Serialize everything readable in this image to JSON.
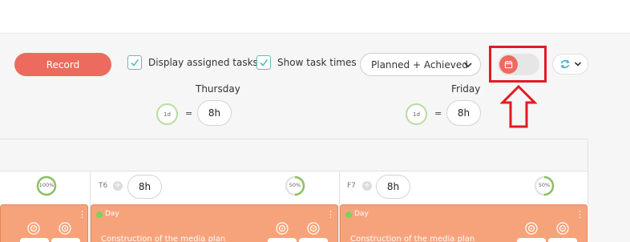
{
  "toolbar": {
    "record_label": "Record",
    "display_assigned_label": "Display assigned tasks",
    "show_times_label": "Show task times",
    "view_select_value": "Planned + Achieved"
  },
  "days": [
    {
      "label": "Thursday",
      "capacity": "1d",
      "equals": "=",
      "hours": "8h"
    },
    {
      "label": "Friday",
      "capacity": "1d",
      "equals": "=",
      "hours": "8h"
    }
  ],
  "columns": [
    {
      "code": "",
      "hours": "",
      "percent": "100%",
      "progress": 1.0
    },
    {
      "code": "T6",
      "hours": "8h",
      "percent": "50%",
      "progress": 0.5
    },
    {
      "code": "F7",
      "hours": "8h",
      "percent": "50%",
      "progress": 0.5
    }
  ],
  "tasks": [
    {
      "tag": "",
      "title": ""
    },
    {
      "tag": "Day",
      "title": "Construction of the media plan"
    },
    {
      "tag": "Day",
      "title": "Construction of the media plan"
    }
  ],
  "colors": {
    "accent": "#ec6b5e",
    "task_bg": "#f6a37c",
    "highlight": "#e11b22",
    "check": "#5fbdb8",
    "progress": "#8cc063"
  }
}
